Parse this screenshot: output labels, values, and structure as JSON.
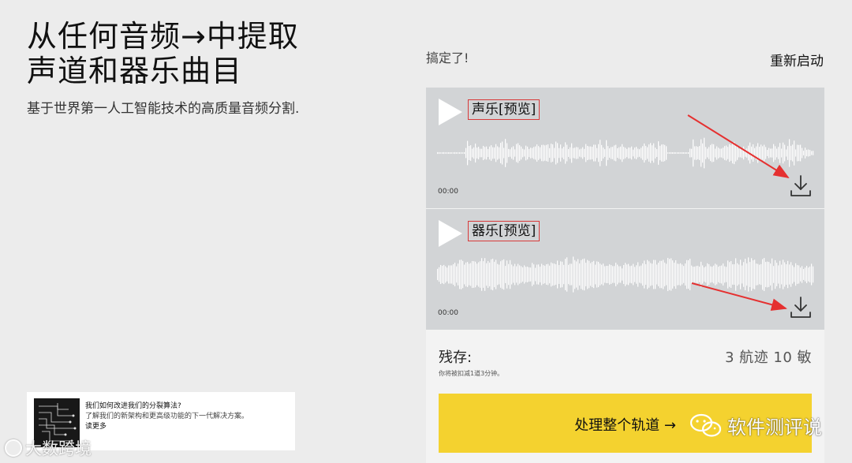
{
  "hero": {
    "title_line1": "从任何音频→中提取",
    "title_line2": "声道和器乐曲目",
    "subtitle": "基于世界第一人工智能技术的高质量音频分割."
  },
  "promo": {
    "title": "我们如何改进我们的分裂算法?",
    "description": "了解我们的新架构和更高级功能的下一代解决方案。",
    "link": "读更多"
  },
  "status": {
    "done_text": "搞定了!",
    "restart_label": "重新启动"
  },
  "tracks": [
    {
      "label": "声乐[预览]",
      "time": "00:00"
    },
    {
      "label": "器乐[预览]",
      "time": "00:00"
    }
  ],
  "remaining": {
    "label": "残存:",
    "values": "3 航迹  10 敏",
    "note": "你将被扣减1道3分钟。"
  },
  "process_button": {
    "label": "处理整个轨道 →"
  },
  "watermarks": {
    "left": "大数跨境",
    "right": "软件测评说"
  },
  "colors": {
    "background": "#ececec",
    "track_bg": "#d2d4d6",
    "accent_yellow": "#f4d22f",
    "annotation_red": "#d83a3a"
  },
  "icons": {
    "play": "play-icon",
    "download": "download-icon",
    "wechat": "wechat-icon"
  }
}
